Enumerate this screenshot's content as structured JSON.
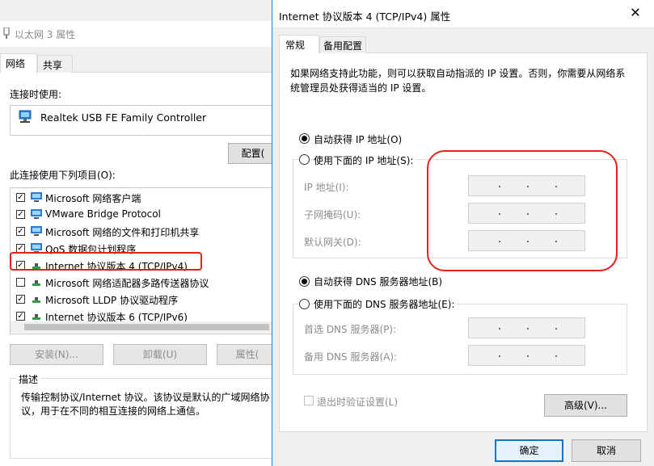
{
  "back_window": {
    "title": "以太网 3 属性",
    "tabs": [
      "网络",
      "共享"
    ],
    "connect_using_label": "连接时使用:",
    "adapter_name": "Realtek USB FE Family Controller",
    "configure_label": "配置(",
    "items_label": "此连接使用下列项目(O):",
    "items": [
      {
        "label": "Microsoft 网络客户端",
        "checked": true,
        "icon": "network-client-icon"
      },
      {
        "label": "VMware Bridge Protocol",
        "checked": true,
        "icon": "network-protocol-icon"
      },
      {
        "label": "Microsoft 网络的文件和打印机共享",
        "checked": true,
        "icon": "network-service-icon"
      },
      {
        "label": "QoS 数据包计划程序",
        "checked": true,
        "icon": "network-service-icon"
      },
      {
        "label": "Internet 协议版本 4 (TCP/IPv4)",
        "checked": true,
        "icon": "protocol-icon"
      },
      {
        "label": "Microsoft 网络适配器多路传送器协议",
        "checked": false,
        "icon": "protocol-icon"
      },
      {
        "label": "Microsoft LLDP 协议驱动程序",
        "checked": true,
        "icon": "protocol-icon"
      },
      {
        "label": "Internet 协议版本 6 (TCP/IPv6)",
        "checked": true,
        "icon": "protocol-icon"
      }
    ],
    "buttons": {
      "install": "安装(N)...",
      "uninstall": "卸载(U)",
      "properties": "属性("
    },
    "description_legend": "描述",
    "description_text": "传输控制协议/Internet 协议。该协议是默认的广域网络协议，用于在不同的相互连接的网络上通信。"
  },
  "dialog": {
    "title": "Internet 协议版本 4 (TCP/IPv4) 属性",
    "tabs": {
      "general": "常规",
      "alternate": "备用配置"
    },
    "intro": "如果网络支持此功能，则可以获取自动指派的 IP 设置。否则，你需要从网络系统管理员处获得适当的 IP 设置。",
    "ip_auto": "自动获得 IP 地址(O)",
    "ip_manual": "使用下面的 IP 地址(S):",
    "ip_fields": {
      "ip": "IP 地址(I):",
      "mask": "子网掩码(U):",
      "gateway": "默认网关(D):"
    },
    "dns_auto": "自动获得 DNS 服务器地址(B)",
    "dns_manual": "使用下面的 DNS 服务器地址(E):",
    "dns_fields": {
      "preferred": "首选 DNS 服务器(P):",
      "alternate": "备用 DNS 服务器(A):"
    },
    "validate_on_exit": "退出时验证设置(L)",
    "advanced": "高级(V)...",
    "ok": "确定",
    "cancel": "取消",
    "close_glyph": "✕",
    "ip_mode": "auto",
    "dns_mode": "auto"
  },
  "colors": {
    "highlight": "#e2231a",
    "accent": "#0078d7"
  }
}
